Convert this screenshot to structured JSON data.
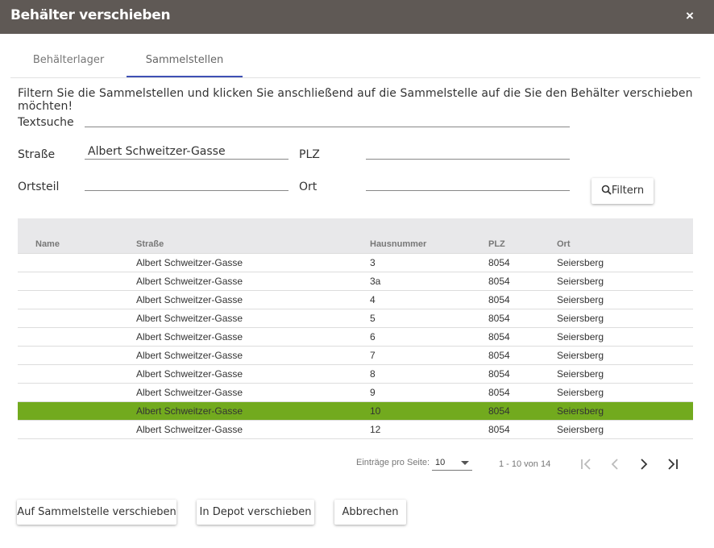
{
  "dialog": {
    "title": "Behälter verschieben",
    "close_label": "×"
  },
  "tabs": [
    {
      "label": "Behälterlager"
    },
    {
      "label": "Sammelstellen"
    }
  ],
  "intro": "Filtern Sie die Sammelstellen und klicken Sie anschließend auf die Sammelstelle auf die Sie den Behälter verschieben möchten!",
  "filters": {
    "textsuche": {
      "label": "Textsuche",
      "value": ""
    },
    "strasse": {
      "label": "Straße",
      "value": "Albert Schweitzer-Gasse"
    },
    "plz": {
      "label": "PLZ",
      "value": ""
    },
    "ortsteil": {
      "label": "Ortsteil",
      "value": ""
    },
    "ort": {
      "label": "Ort",
      "value": ""
    },
    "filter_button": "Filtern"
  },
  "table": {
    "headers": {
      "name": "Name",
      "strasse": "Straße",
      "hausnummer": "Hausnummer",
      "plz": "PLZ",
      "ort": "Ort"
    },
    "rows": [
      {
        "name": "",
        "strasse": "Albert Schweitzer-Gasse",
        "hausnummer": "3",
        "plz": "8054",
        "ort": "Seiersberg"
      },
      {
        "name": "",
        "strasse": "Albert Schweitzer-Gasse",
        "hausnummer": "3a",
        "plz": "8054",
        "ort": "Seiersberg"
      },
      {
        "name": "",
        "strasse": "Albert Schweitzer-Gasse",
        "hausnummer": "4",
        "plz": "8054",
        "ort": "Seiersberg"
      },
      {
        "name": "",
        "strasse": "Albert Schweitzer-Gasse",
        "hausnummer": "5",
        "plz": "8054",
        "ort": "Seiersberg"
      },
      {
        "name": "",
        "strasse": "Albert Schweitzer-Gasse",
        "hausnummer": "6",
        "plz": "8054",
        "ort": "Seiersberg"
      },
      {
        "name": "",
        "strasse": "Albert Schweitzer-Gasse",
        "hausnummer": "7",
        "plz": "8054",
        "ort": "Seiersberg"
      },
      {
        "name": "",
        "strasse": "Albert Schweitzer-Gasse",
        "hausnummer": "8",
        "plz": "8054",
        "ort": "Seiersberg"
      },
      {
        "name": "",
        "strasse": "Albert Schweitzer-Gasse",
        "hausnummer": "9",
        "plz": "8054",
        "ort": "Seiersberg"
      },
      {
        "name": "",
        "strasse": "Albert Schweitzer-Gasse",
        "hausnummer": "10",
        "plz": "8054",
        "ort": "Seiersberg",
        "selected": true
      },
      {
        "name": "",
        "strasse": "Albert Schweitzer-Gasse",
        "hausnummer": "12",
        "plz": "8054",
        "ort": "Seiersberg"
      }
    ]
  },
  "paginator": {
    "items_per_page_label": "Einträge pro Seite:",
    "items_per_page": "10",
    "range": "1 - 10 von 14",
    "icons": [
      "first-page-icon",
      "previous-page-icon",
      "next-page-icon",
      "last-page-icon"
    ]
  },
  "actions": {
    "move_to_collection": "Auf Sammelstelle verschieben",
    "move_to_depot": "In Depot verschieben",
    "cancel": "Abbrechen"
  },
  "colors": {
    "titlebar": "#5f5955",
    "tab_indicator": "#3f51b5",
    "selected_row": "#72aa1e"
  }
}
